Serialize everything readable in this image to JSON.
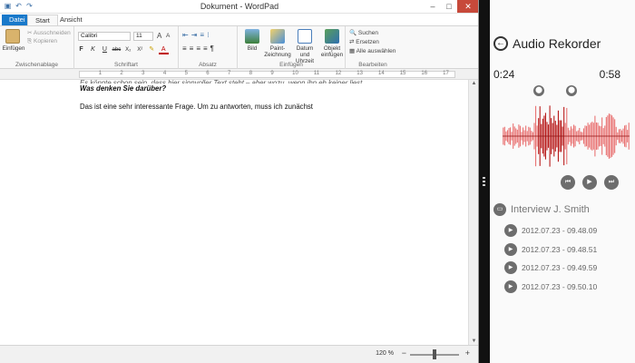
{
  "wordpad": {
    "title": "Dokument - WordPad",
    "qat_icons": [
      "save-icon",
      "undo-icon",
      "redo-icon"
    ],
    "window_controls": {
      "minimize": "–",
      "maximize": "□",
      "close": "✕"
    },
    "tabs": {
      "file": "Datei",
      "start": "Start",
      "view": "Ansicht"
    },
    "ribbon": {
      "clipboard": {
        "label": "Zwischenablage",
        "paste": "Einfügen",
        "cut": "Ausschneiden",
        "copy": "Kopieren"
      },
      "font": {
        "label": "Schriftart",
        "family": "Calibri",
        "size": "11",
        "grow": "A",
        "shrink": "A",
        "buttons": [
          "F",
          "K",
          "U",
          "abc",
          "X₂",
          "X²"
        ],
        "highlight": "✎",
        "color": "A"
      },
      "paragraph": {
        "label": "Absatz"
      },
      "insert": {
        "label": "Einfügen",
        "image": "Bild",
        "paint": "Paint-Zeichnung",
        "datetime": "Datum und Uhrzeit",
        "object": "Objekt einfügen"
      },
      "edit": {
        "label": "Bearbeiten",
        "find": "Suchen",
        "replace": "Ersetzen",
        "select_all": "Alle auswählen"
      }
    },
    "ruler_numbers": [
      "1",
      "2",
      "3",
      "4",
      "5",
      "6",
      "7",
      "8",
      "9",
      "10",
      "11",
      "12",
      "13",
      "14",
      "15",
      "16",
      "17"
    ],
    "document": {
      "line_cut": "Es könnte schon sein, dass hier sinnvoller Text steht – aber wozu, wenn ihn eh keiner liest.",
      "question": "Was denken Sie darüber?",
      "paragraph": "Das ist eine sehr interessante Frage. Um zu antworten, muss ich zunächst"
    },
    "status": {
      "zoom": "120 %",
      "minus": "−",
      "plus": "+"
    }
  },
  "recorder": {
    "title": "Audio Rekorder",
    "time_start": "0:24",
    "time_end": "0:58",
    "folder": "Interview J. Smith",
    "recordings": [
      "2012.07.23 - 09.48.09",
      "2012.07.23 - 09.48.51",
      "2012.07.23 - 09.49.59",
      "2012.07.23 - 09.50.10"
    ],
    "colors": {
      "waveform": "#e23b3b",
      "icon_bg": "#6d6d6d"
    }
  }
}
